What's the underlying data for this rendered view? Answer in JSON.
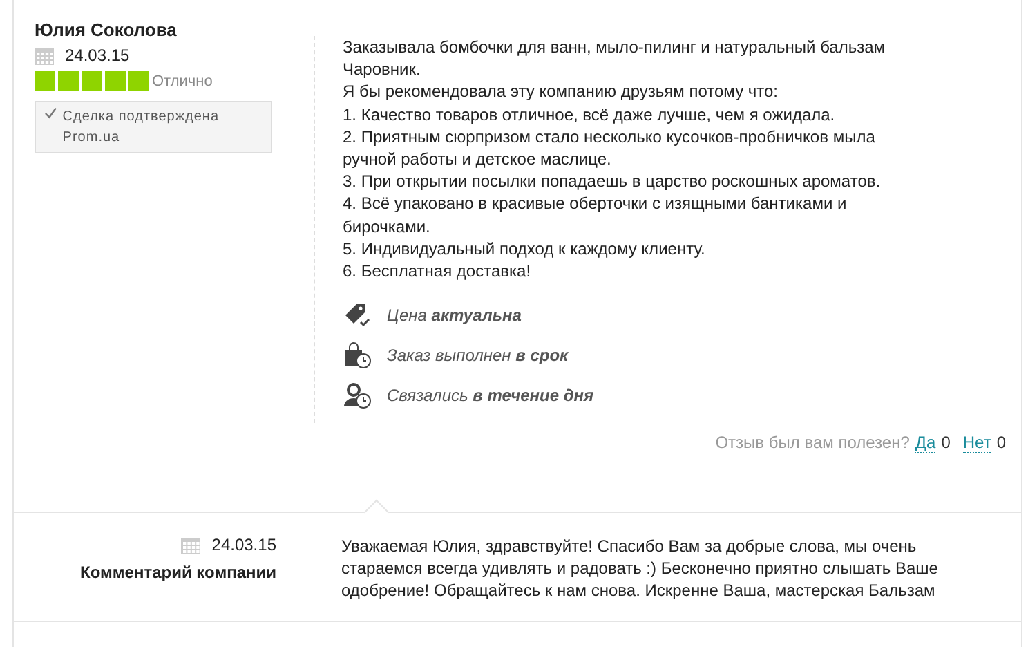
{
  "review": {
    "author": "Юлия Соколова",
    "date": "24.03.15",
    "stars": 5,
    "rating_label": "Отлично",
    "verified": {
      "checked": true,
      "text": "Сделка подтверждена Prom.ua"
    },
    "body_lines": [
      "Заказывала бомбочки для ванн, мыло-пилинг и натуральный бальзам",
      "Чаровник.",
      "Я бы рекомендовала эту компанию друзьям потому что:",
      "1. Качество товаров отличное, всё даже лучше, чем я ожидала.",
      "2. Приятным сюрпризом стало несколько кусочков-пробничков мыла",
      "ручной работы и детское маслице.",
      "3. При открытии посылки попадаешь в царство роскошных ароматов.",
      "4. Всё упаковано в красивые оберточки с изящными бантиками и",
      "бирочками.",
      "5. Индивидуальный подход к каждому клиенту.",
      "6. Бесплатная доставка!"
    ],
    "features": [
      {
        "kind": "price",
        "text": "Цена **актуальна**"
      },
      {
        "kind": "order",
        "text": "Заказ выполнен **в срок**"
      },
      {
        "kind": "contact",
        "text": "Связались **в течение дня**"
      }
    ],
    "helpful": {
      "question": "Отзыв был вам полезен?",
      "yes_label": "Да",
      "yes_count": "0",
      "no_label": "Нет",
      "no_count": "0"
    }
  },
  "company_comment": {
    "date": "24.03.15",
    "label": "Комментарий компании",
    "lines": [
      "Уважаемая Юлия, здравствуйте! Спасибо Вам за добрые слова, мы очень",
      "стараемся всегда удивлять и радовать :) Бесконечно приятно слышать Ваше",
      "одобрение! Обращайтесь к нам снова. Искренне Ваша, мастерская Бальзам"
    ]
  }
}
